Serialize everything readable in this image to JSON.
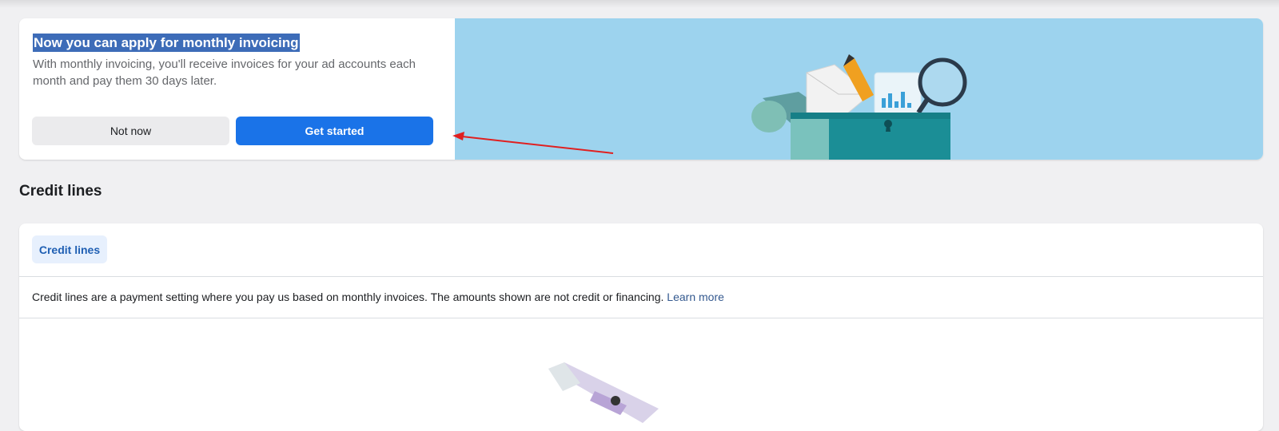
{
  "banner": {
    "title": "Now you can apply for monthly invoicing",
    "description": "With monthly invoicing, you'll receive invoices for your ad accounts each month and pay them 30 days later.",
    "not_now_label": "Not now",
    "get_started_label": "Get started"
  },
  "section": {
    "heading": "Credit lines"
  },
  "card": {
    "tab_label": "Credit lines",
    "info_text": "Credit lines are a payment setting where you pay us based on monthly invoices. The amounts shown are not credit or financing.",
    "learn_more": "Learn more"
  },
  "colors": {
    "primary": "#1a73e8",
    "banner_art_bg": "#9dd3ee",
    "annotation_arrow": "#e02020"
  }
}
